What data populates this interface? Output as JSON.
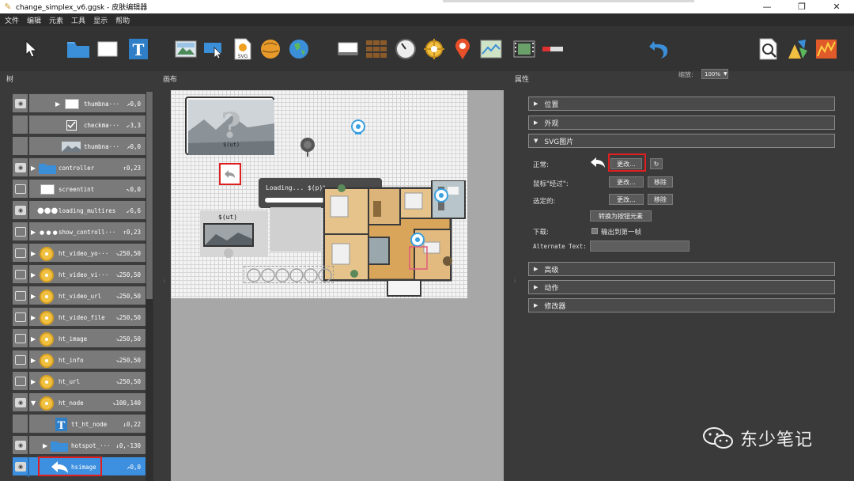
{
  "window": {
    "title": "change_simplex_v6.ggsk - 皮肤编辑器"
  },
  "menu": [
    "文件",
    "编辑",
    "元素",
    "工具",
    "显示",
    "帮助"
  ],
  "toolbar": {
    "zoom_label": "缩放:",
    "zoom_value": "100%"
  },
  "panels": {
    "tree": "树",
    "canvas": "画布",
    "properties": "属性"
  },
  "tree": {
    "rows": [
      {
        "name": "thumbna···",
        "pos": "↗0,0",
        "icon": "white-rect-icon"
      },
      {
        "name": "checkma···",
        "pos": "↙3,3",
        "icon": "checkbox-icon"
      },
      {
        "name": "thumbna···",
        "pos": "↗0,0",
        "icon": "image-thumb-icon"
      },
      {
        "name": "controller",
        "pos": "↑0,23",
        "icon": "folder-icon"
      },
      {
        "name": "screentint",
        "pos": "↖0,0",
        "icon": "white-rect-icon"
      },
      {
        "name": "loading_multires",
        "pos": "↙6,6",
        "icon": "dots-icon"
      },
      {
        "name": "show_controll···",
        "pos": "↑0,23",
        "icon": "dots-icon"
      },
      {
        "name": "ht_video_yo···",
        "pos": "↘250,50",
        "icon": "hotspot-icon"
      },
      {
        "name": "ht_video_vi···",
        "pos": "↘250,50",
        "icon": "hotspot-icon"
      },
      {
        "name": "ht_video_url",
        "pos": "↘250,50",
        "icon": "hotspot-icon"
      },
      {
        "name": "ht_video_file",
        "pos": "↘250,50",
        "icon": "hotspot-icon"
      },
      {
        "name": "ht_image",
        "pos": "↘250,50",
        "icon": "hotspot-icon"
      },
      {
        "name": "ht_info",
        "pos": "↘250,50",
        "icon": "hotspot-icon"
      },
      {
        "name": "ht_url",
        "pos": "↘250,50",
        "icon": "hotspot-icon"
      },
      {
        "name": "ht_node",
        "pos": "↘100,140",
        "icon": "hotspot-icon"
      },
      {
        "name": "tt_ht_node",
        "pos": "↓0,22",
        "icon": "text-icon"
      },
      {
        "name": "hotspot_···",
        "pos": "↓0,-130",
        "icon": "folder-icon"
      },
      {
        "name": "hsimage",
        "pos": "↗0,0",
        "icon": "back-arrow-icon"
      }
    ]
  },
  "canvas": {
    "thumb_label": "$(ut)",
    "loading_text": "Loading... $(p)%",
    "node_label": "$(ut)"
  },
  "properties": {
    "sections_top": [
      "位置",
      "外观",
      "SVG图片"
    ],
    "normal_label": "正常:",
    "hover_label": "鼠标\"经过\":",
    "selected_label": "选定的:",
    "change_btn": "更改...",
    "remove_btn": "移除",
    "convert_btn": "转换为按钮元素",
    "download_label": "下载:",
    "export_first_frame": "输出到第一帧",
    "alt_text_label": "Alternate Text:",
    "alt_text_value": "",
    "sections_bottom": [
      "高级",
      "动作",
      "修改器"
    ]
  },
  "watermark": {
    "text": "东少笔记"
  },
  "colors": {
    "selection": "#3d8fe0",
    "highlight_box": "#e02020"
  }
}
